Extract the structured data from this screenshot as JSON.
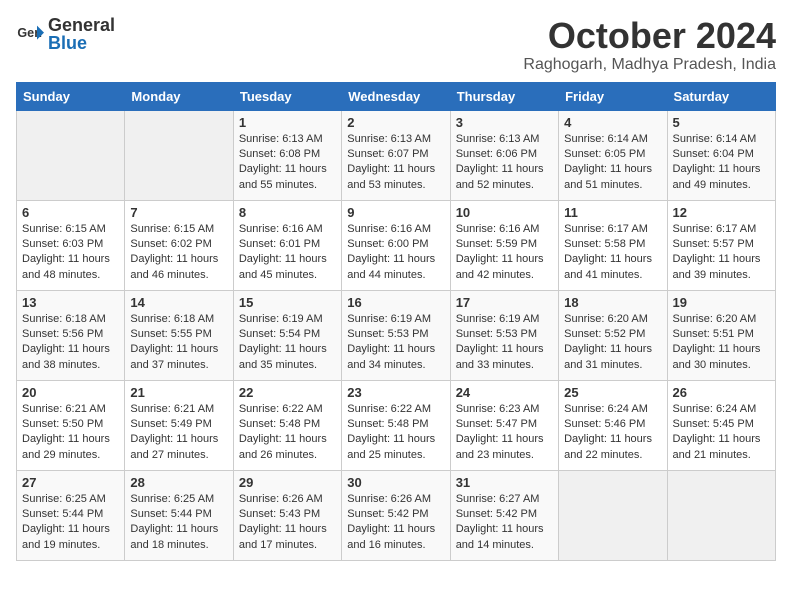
{
  "header": {
    "logo_general": "General",
    "logo_blue": "Blue",
    "month": "October 2024",
    "location": "Raghogarh, Madhya Pradesh, India"
  },
  "days_of_week": [
    "Sunday",
    "Monday",
    "Tuesday",
    "Wednesday",
    "Thursday",
    "Friday",
    "Saturday"
  ],
  "weeks": [
    [
      {
        "day": "",
        "sunrise": "",
        "sunset": "",
        "daylight": ""
      },
      {
        "day": "",
        "sunrise": "",
        "sunset": "",
        "daylight": ""
      },
      {
        "day": "1",
        "sunrise": "Sunrise: 6:13 AM",
        "sunset": "Sunset: 6:08 PM",
        "daylight": "Daylight: 11 hours and 55 minutes."
      },
      {
        "day": "2",
        "sunrise": "Sunrise: 6:13 AM",
        "sunset": "Sunset: 6:07 PM",
        "daylight": "Daylight: 11 hours and 53 minutes."
      },
      {
        "day": "3",
        "sunrise": "Sunrise: 6:13 AM",
        "sunset": "Sunset: 6:06 PM",
        "daylight": "Daylight: 11 hours and 52 minutes."
      },
      {
        "day": "4",
        "sunrise": "Sunrise: 6:14 AM",
        "sunset": "Sunset: 6:05 PM",
        "daylight": "Daylight: 11 hours and 51 minutes."
      },
      {
        "day": "5",
        "sunrise": "Sunrise: 6:14 AM",
        "sunset": "Sunset: 6:04 PM",
        "daylight": "Daylight: 11 hours and 49 minutes."
      }
    ],
    [
      {
        "day": "6",
        "sunrise": "Sunrise: 6:15 AM",
        "sunset": "Sunset: 6:03 PM",
        "daylight": "Daylight: 11 hours and 48 minutes."
      },
      {
        "day": "7",
        "sunrise": "Sunrise: 6:15 AM",
        "sunset": "Sunset: 6:02 PM",
        "daylight": "Daylight: 11 hours and 46 minutes."
      },
      {
        "day": "8",
        "sunrise": "Sunrise: 6:16 AM",
        "sunset": "Sunset: 6:01 PM",
        "daylight": "Daylight: 11 hours and 45 minutes."
      },
      {
        "day": "9",
        "sunrise": "Sunrise: 6:16 AM",
        "sunset": "Sunset: 6:00 PM",
        "daylight": "Daylight: 11 hours and 44 minutes."
      },
      {
        "day": "10",
        "sunrise": "Sunrise: 6:16 AM",
        "sunset": "Sunset: 5:59 PM",
        "daylight": "Daylight: 11 hours and 42 minutes."
      },
      {
        "day": "11",
        "sunrise": "Sunrise: 6:17 AM",
        "sunset": "Sunset: 5:58 PM",
        "daylight": "Daylight: 11 hours and 41 minutes."
      },
      {
        "day": "12",
        "sunrise": "Sunrise: 6:17 AM",
        "sunset": "Sunset: 5:57 PM",
        "daylight": "Daylight: 11 hours and 39 minutes."
      }
    ],
    [
      {
        "day": "13",
        "sunrise": "Sunrise: 6:18 AM",
        "sunset": "Sunset: 5:56 PM",
        "daylight": "Daylight: 11 hours and 38 minutes."
      },
      {
        "day": "14",
        "sunrise": "Sunrise: 6:18 AM",
        "sunset": "Sunset: 5:55 PM",
        "daylight": "Daylight: 11 hours and 37 minutes."
      },
      {
        "day": "15",
        "sunrise": "Sunrise: 6:19 AM",
        "sunset": "Sunset: 5:54 PM",
        "daylight": "Daylight: 11 hours and 35 minutes."
      },
      {
        "day": "16",
        "sunrise": "Sunrise: 6:19 AM",
        "sunset": "Sunset: 5:53 PM",
        "daylight": "Daylight: 11 hours and 34 minutes."
      },
      {
        "day": "17",
        "sunrise": "Sunrise: 6:19 AM",
        "sunset": "Sunset: 5:53 PM",
        "daylight": "Daylight: 11 hours and 33 minutes."
      },
      {
        "day": "18",
        "sunrise": "Sunrise: 6:20 AM",
        "sunset": "Sunset: 5:52 PM",
        "daylight": "Daylight: 11 hours and 31 minutes."
      },
      {
        "day": "19",
        "sunrise": "Sunrise: 6:20 AM",
        "sunset": "Sunset: 5:51 PM",
        "daylight": "Daylight: 11 hours and 30 minutes."
      }
    ],
    [
      {
        "day": "20",
        "sunrise": "Sunrise: 6:21 AM",
        "sunset": "Sunset: 5:50 PM",
        "daylight": "Daylight: 11 hours and 29 minutes."
      },
      {
        "day": "21",
        "sunrise": "Sunrise: 6:21 AM",
        "sunset": "Sunset: 5:49 PM",
        "daylight": "Daylight: 11 hours and 27 minutes."
      },
      {
        "day": "22",
        "sunrise": "Sunrise: 6:22 AM",
        "sunset": "Sunset: 5:48 PM",
        "daylight": "Daylight: 11 hours and 26 minutes."
      },
      {
        "day": "23",
        "sunrise": "Sunrise: 6:22 AM",
        "sunset": "Sunset: 5:48 PM",
        "daylight": "Daylight: 11 hours and 25 minutes."
      },
      {
        "day": "24",
        "sunrise": "Sunrise: 6:23 AM",
        "sunset": "Sunset: 5:47 PM",
        "daylight": "Daylight: 11 hours and 23 minutes."
      },
      {
        "day": "25",
        "sunrise": "Sunrise: 6:24 AM",
        "sunset": "Sunset: 5:46 PM",
        "daylight": "Daylight: 11 hours and 22 minutes."
      },
      {
        "day": "26",
        "sunrise": "Sunrise: 6:24 AM",
        "sunset": "Sunset: 5:45 PM",
        "daylight": "Daylight: 11 hours and 21 minutes."
      }
    ],
    [
      {
        "day": "27",
        "sunrise": "Sunrise: 6:25 AM",
        "sunset": "Sunset: 5:44 PM",
        "daylight": "Daylight: 11 hours and 19 minutes."
      },
      {
        "day": "28",
        "sunrise": "Sunrise: 6:25 AM",
        "sunset": "Sunset: 5:44 PM",
        "daylight": "Daylight: 11 hours and 18 minutes."
      },
      {
        "day": "29",
        "sunrise": "Sunrise: 6:26 AM",
        "sunset": "Sunset: 5:43 PM",
        "daylight": "Daylight: 11 hours and 17 minutes."
      },
      {
        "day": "30",
        "sunrise": "Sunrise: 6:26 AM",
        "sunset": "Sunset: 5:42 PM",
        "daylight": "Daylight: 11 hours and 16 minutes."
      },
      {
        "day": "31",
        "sunrise": "Sunrise: 6:27 AM",
        "sunset": "Sunset: 5:42 PM",
        "daylight": "Daylight: 11 hours and 14 minutes."
      },
      {
        "day": "",
        "sunrise": "",
        "sunset": "",
        "daylight": ""
      },
      {
        "day": "",
        "sunrise": "",
        "sunset": "",
        "daylight": ""
      }
    ]
  ]
}
